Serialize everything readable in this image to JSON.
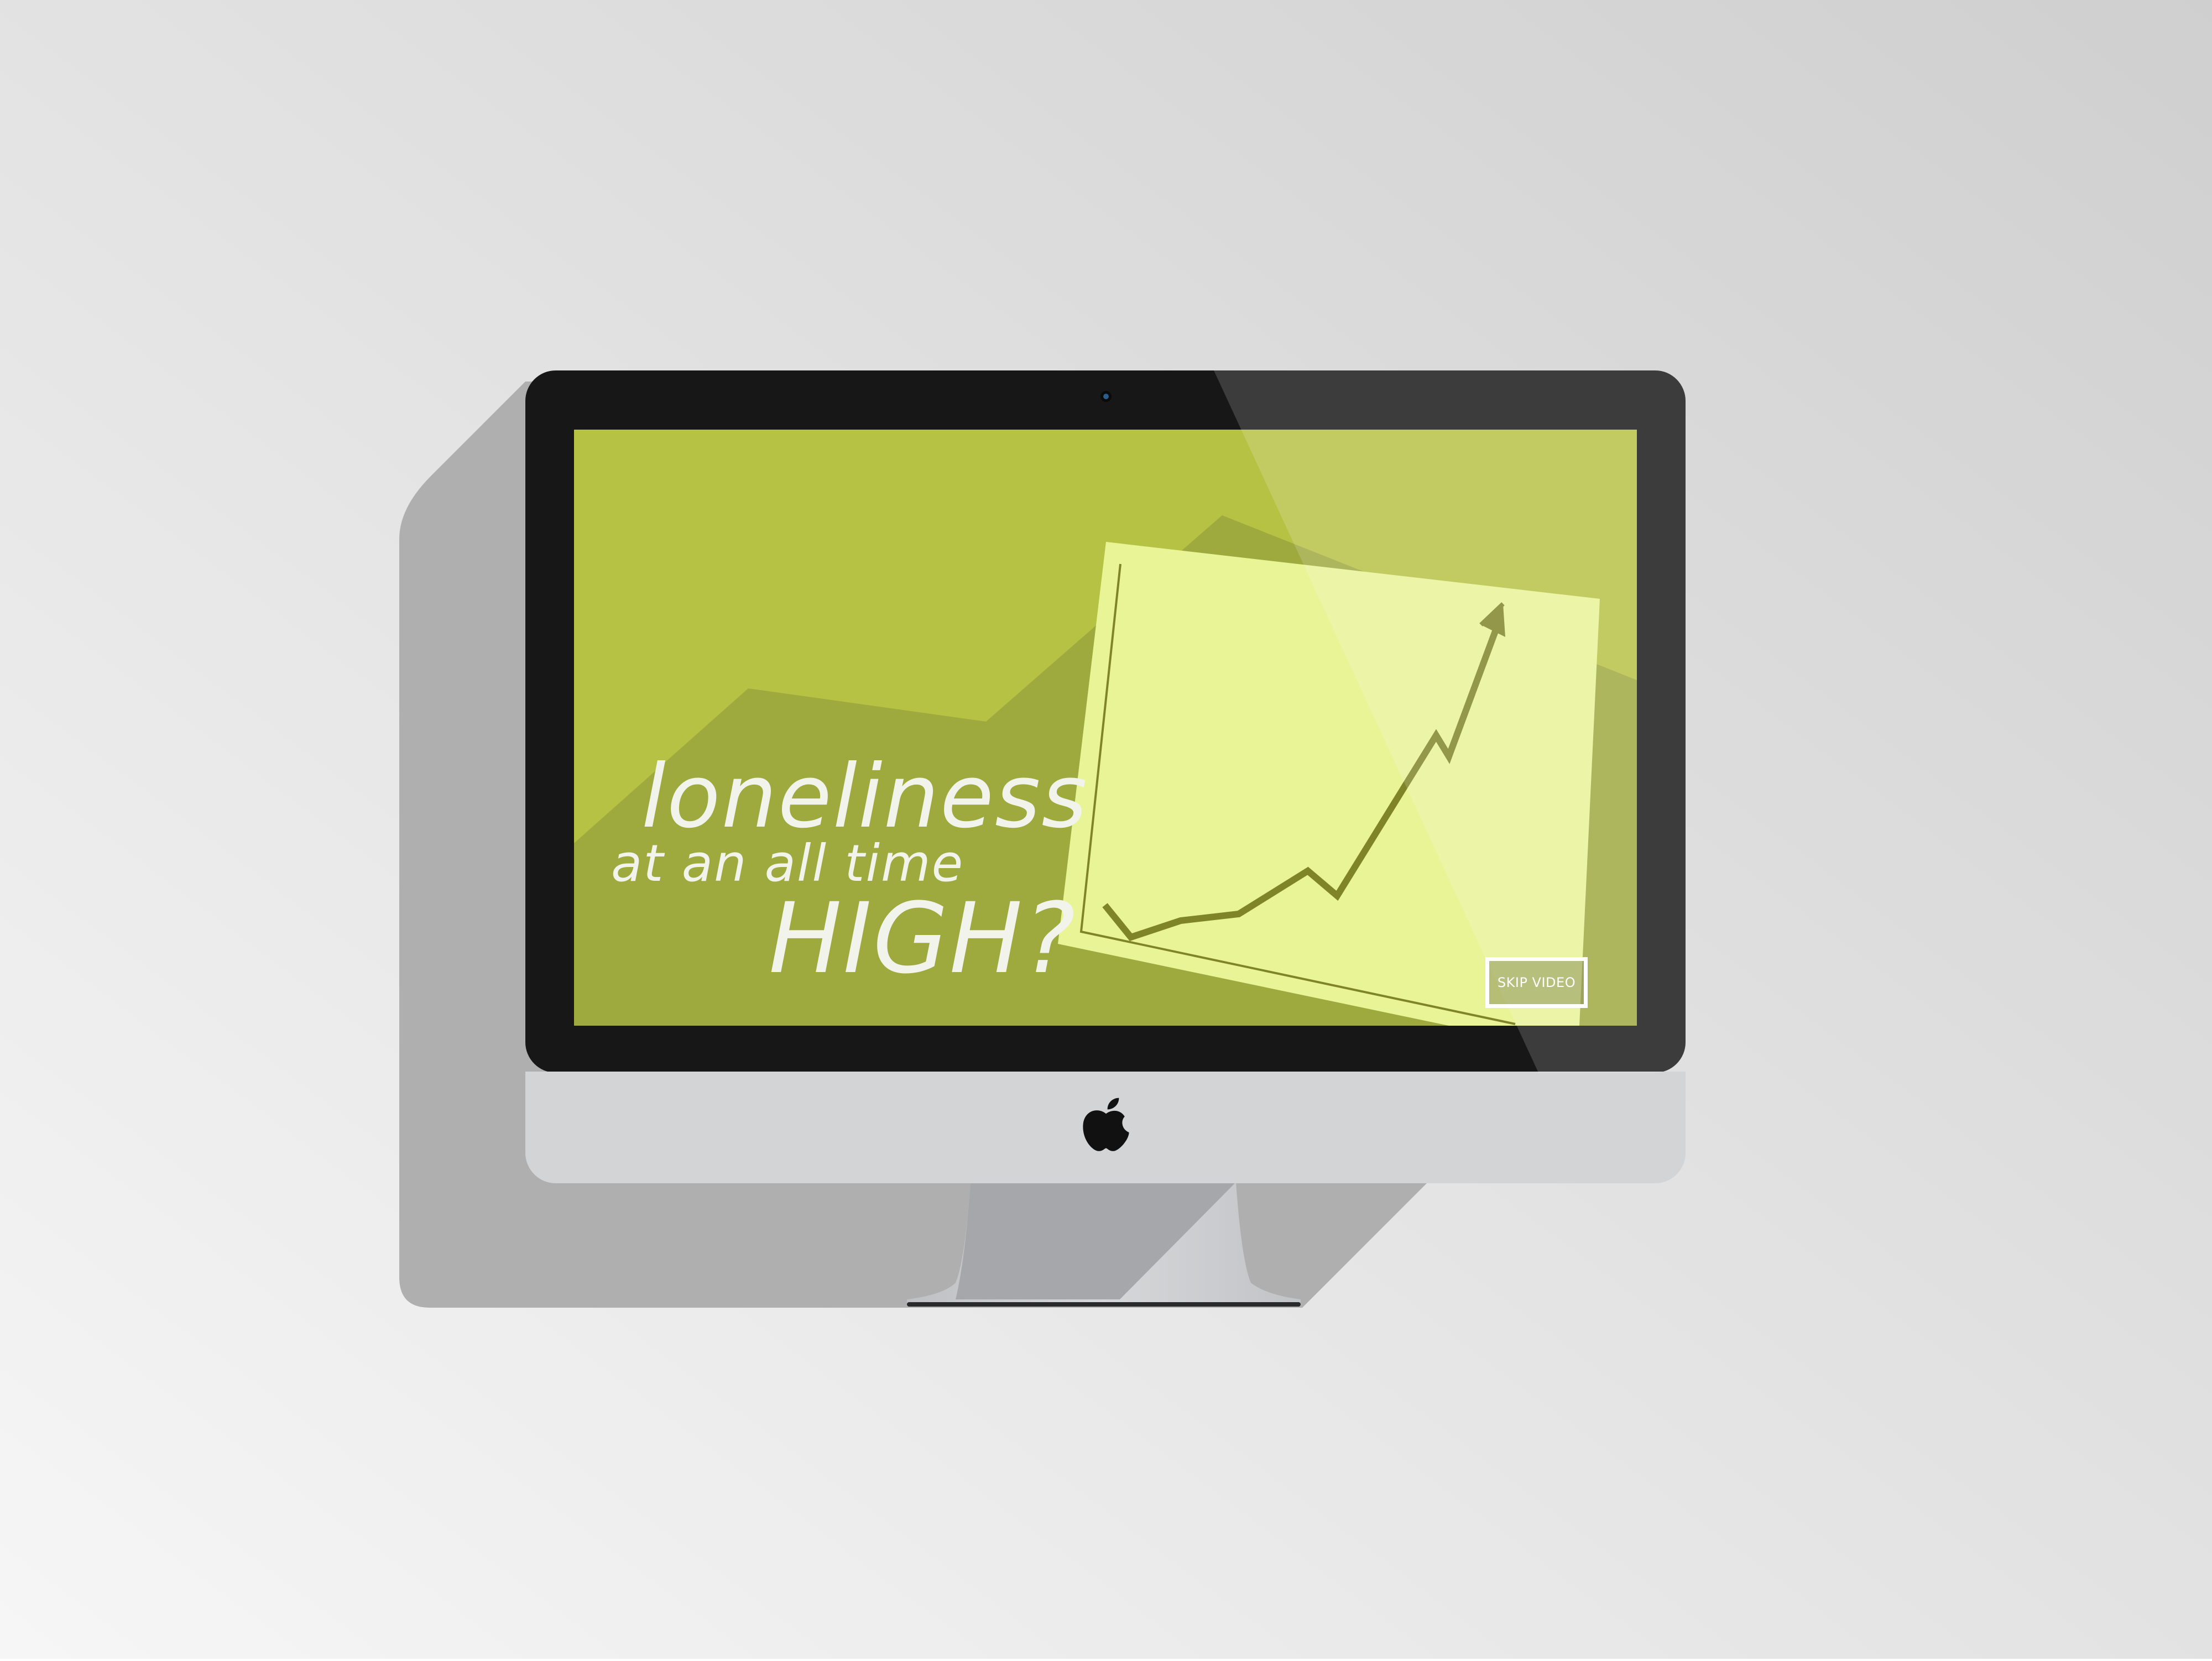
{
  "video": {
    "headline_line1": "loneliness",
    "headline_line2": "at an all time",
    "headline_line3": "HIGH?",
    "skip_label": "SKIP VIDEO"
  },
  "device": {
    "logo_icon": "apple-logo-icon",
    "camera_icon": "webcam-icon"
  },
  "colors": {
    "screen_background": "#b5c244",
    "screen_hill": "#9ea93e",
    "card": "#e9f497",
    "trend_line": "#7f8428",
    "bezel": "#171717",
    "chin": "#d3d4d6",
    "shadow": "#afafaf"
  }
}
